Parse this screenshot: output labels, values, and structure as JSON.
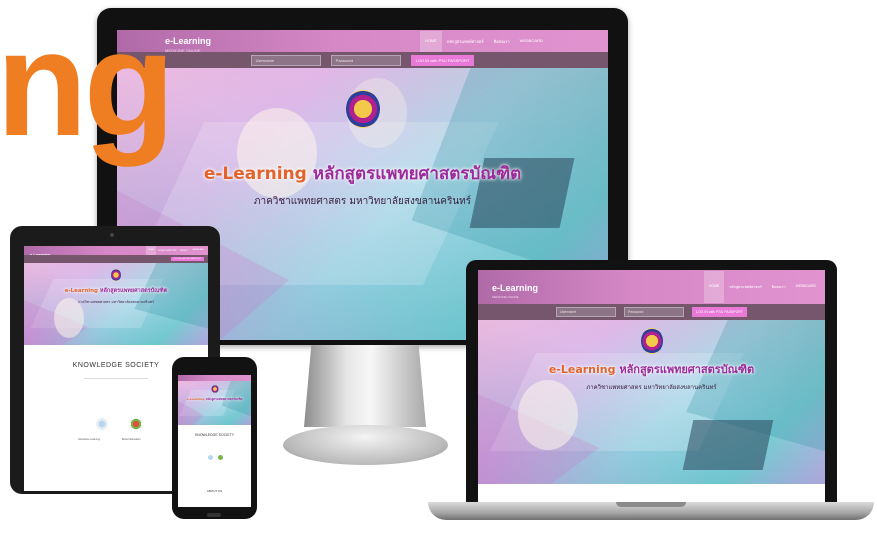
{
  "overlay": {
    "big_text": "ng"
  },
  "site": {
    "logo": "e-Learning",
    "logo_sub": "MEDICINE ONLINE",
    "menu": [
      "HOME",
      "หลักสูตรแพทย์ศาสตร์",
      "ติดต่อเรา",
      "WEBBOARD"
    ],
    "login": {
      "username_placeholder": "Username",
      "password_placeholder": "Password",
      "login_button": "LOG IN with PSU PASSPORT"
    },
    "hero_title_hl": "e-Learning",
    "hero_title_rest": " หลักสูตรแพทยศาสตรบัณฑิต",
    "hero_subtitle": "ภาควิชาแพทยศาสตร มหาวิทยาลัยสงขลานครินทร์"
  },
  "tablet": {
    "section_title": "KNOWLEDGE SOCIETY",
    "item1": "Interactive Learning",
    "item2": "Better Education"
  },
  "phone": {
    "section_title": "KNOWLEDGE SOCIETY",
    "footer": "ABOUT US"
  },
  "colors": {
    "accent_orange": "#ef7d22",
    "nav_pink": "#d688c6",
    "title_purple": "#9c2a9b"
  }
}
